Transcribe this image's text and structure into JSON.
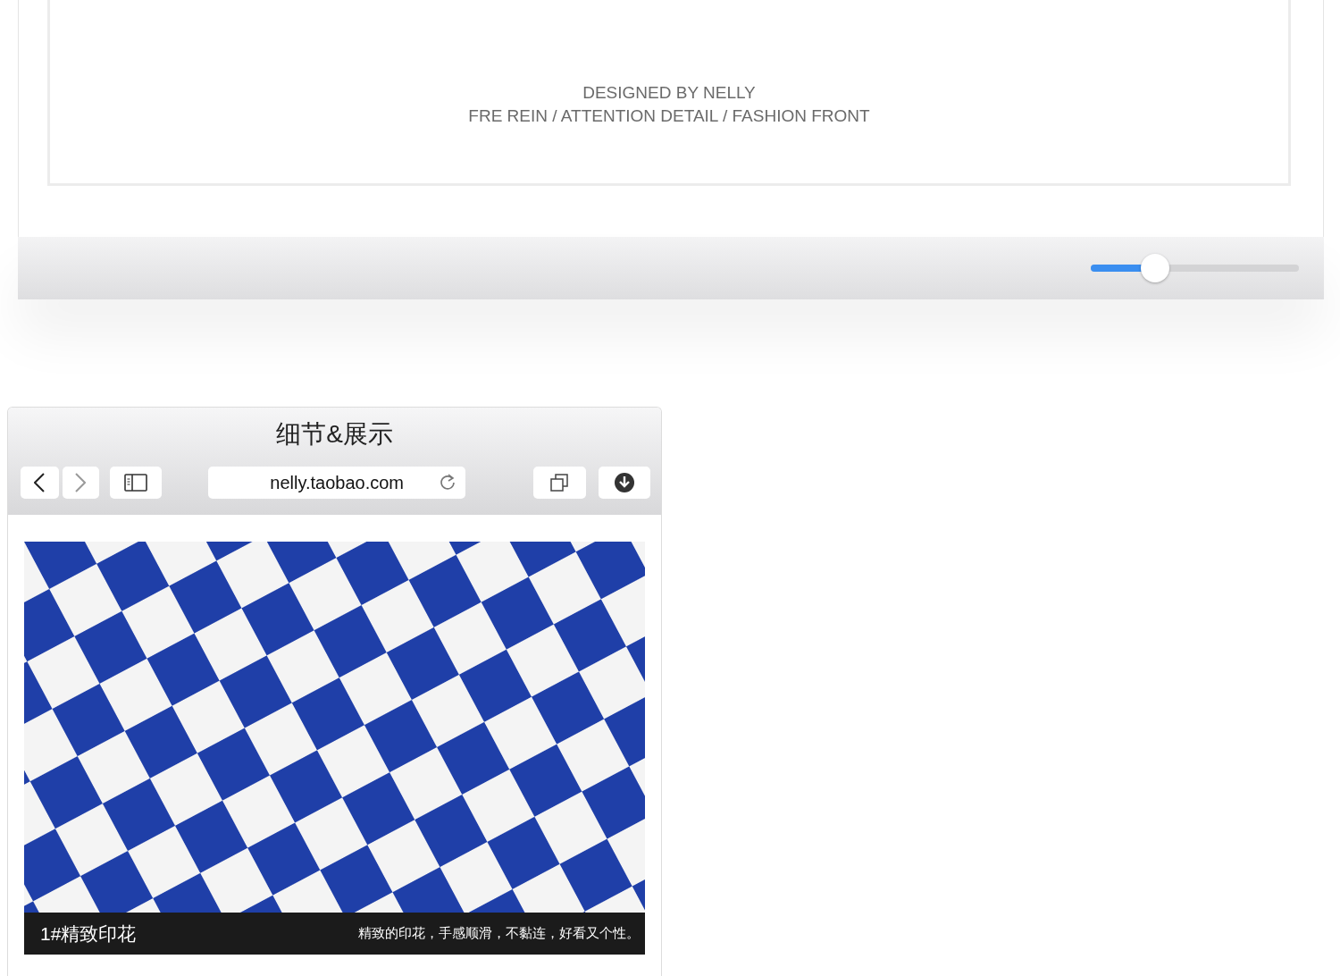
{
  "top_panel": {
    "lines": [
      "DESIGNED BY NELLY",
      "FRE REIN / ATTENTION DETAIL / FASHION FRONT"
    ],
    "slider": {
      "level": 0.31
    }
  },
  "browser": {
    "title": "细节&展示",
    "nav": [
      {
        "kind": "back",
        "disabled": false
      },
      {
        "kind": "forward",
        "disabled": true
      }
    ],
    "url": "nelly.taobao.com",
    "photo": {
      "caption_title": "1#精致印花",
      "caption_text": "精致的印花，手感顺滑，不黏连，好看又个性。"
    }
  }
}
